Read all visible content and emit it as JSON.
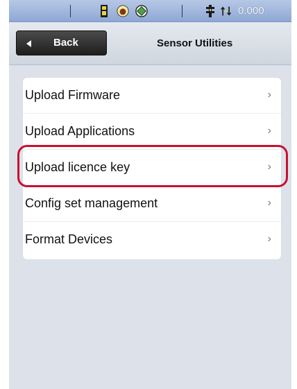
{
  "status_bar": {
    "icons": [
      "device-icon",
      "hand-icon",
      "target-icon",
      "antenna-icon",
      "arrows-icon"
    ],
    "value": "0.000"
  },
  "header": {
    "back_label": "Back",
    "title": "Sensor Utilities"
  },
  "menu": {
    "items": [
      {
        "label": "Upload Firmware",
        "chevron": "›"
      },
      {
        "label": "Upload Applications",
        "chevron": "›"
      },
      {
        "label": "Upload licence key",
        "chevron": "›"
      },
      {
        "label": "Config set management",
        "chevron": "›"
      },
      {
        "label": "Format Devices",
        "chevron": "›"
      }
    ],
    "highlighted_index": 2
  },
  "colors": {
    "status_bar": "#9fb5dd",
    "highlight": "#c8102e",
    "background": "#dde2ea"
  }
}
